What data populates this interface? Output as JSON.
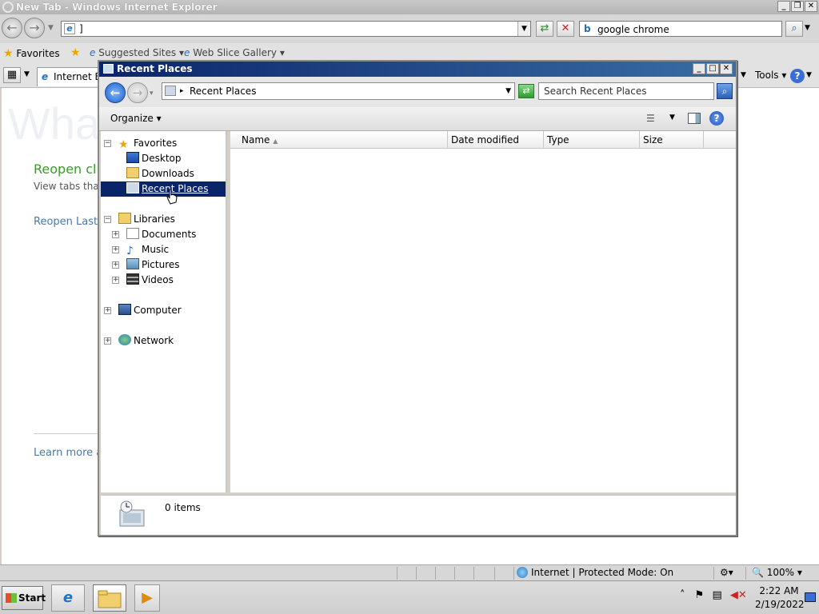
{
  "ie": {
    "title": "New Tab - Windows Internet Explorer",
    "address": "]",
    "search_text": "google chrome",
    "favorites_label": "Favorites",
    "fav_links": [
      "Suggested Sites",
      "Web Slice Gallery"
    ],
    "tab_label": "Internet Ex",
    "tools_label": "Tools",
    "page": {
      "big_title": "Wha",
      "reopen_heading": "Reopen cl",
      "reopen_desc": "View tabs that",
      "reopen_last": "Reopen Last B",
      "learn_more": "Learn more ab"
    },
    "status": {
      "zone": "Internet | Protected Mode: On",
      "zoom": "100%"
    }
  },
  "explorer": {
    "title": "Recent Places",
    "address": "Recent Places",
    "search_placeholder": "Search Recent Places",
    "organize": "Organize",
    "nav_tree": {
      "favorites": "Favorites",
      "desktop": "Desktop",
      "downloads": "Downloads",
      "recent_places": "Recent Places",
      "libraries": "Libraries",
      "documents": "Documents",
      "music": "Music",
      "pictures": "Pictures",
      "videos": "Videos",
      "computer": "Computer",
      "network": "Network"
    },
    "columns": [
      "Name",
      "Date modified",
      "Type",
      "Size"
    ],
    "details": "0 items"
  },
  "taskbar": {
    "start": "Start",
    "time": "2:22 AM",
    "date": "2/19/2022"
  },
  "colors": {
    "selection": "#0a246a",
    "title_bar": "#0a246a",
    "reopen_green": "#3c9a2c",
    "link_blue": "#4a78a8"
  }
}
